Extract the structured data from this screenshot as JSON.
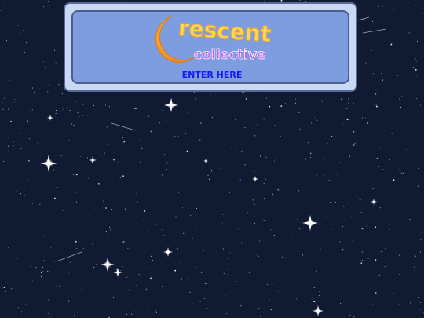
{
  "logo": {
    "line1": "rescent",
    "line2": "collective"
  },
  "enter_link": "ENTER HERE"
}
